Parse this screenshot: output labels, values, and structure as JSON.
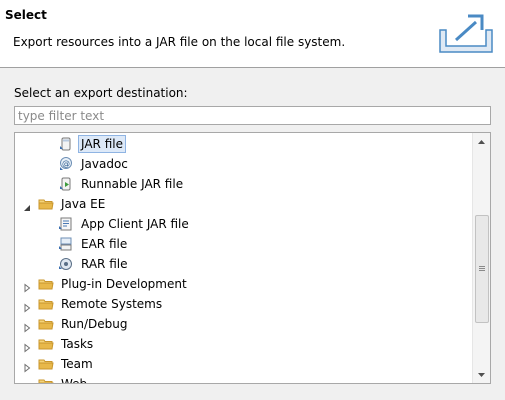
{
  "header": {
    "title": "Select",
    "description": "Export resources into a JAR file on the local file system.",
    "banner_icon": "export-icon"
  },
  "destination_label": "Select an export destination:",
  "filter": {
    "placeholder": "type filter text",
    "value": ""
  },
  "tree": {
    "selected": "JAR file",
    "items": [
      {
        "label": "JAR file",
        "icon": "jar-icon",
        "level": 2,
        "selected": true
      },
      {
        "label": "Javadoc",
        "icon": "javadoc-icon",
        "level": 2
      },
      {
        "label": "Runnable JAR file",
        "icon": "runnable-jar-icon",
        "level": 2
      },
      {
        "label": "Java EE",
        "icon": "folder-icon",
        "level": 1,
        "expanded": true
      },
      {
        "label": "App Client JAR file",
        "icon": "app-client-jar-icon",
        "level": 2
      },
      {
        "label": "EAR file",
        "icon": "ear-icon",
        "level": 2
      },
      {
        "label": "RAR file",
        "icon": "rar-icon",
        "level": 2
      },
      {
        "label": "Plug-in Development",
        "icon": "folder-icon",
        "level": 1,
        "expanded": false
      },
      {
        "label": "Remote Systems",
        "icon": "folder-icon",
        "level": 1,
        "expanded": false
      },
      {
        "label": "Run/Debug",
        "icon": "folder-icon",
        "level": 1,
        "expanded": false
      },
      {
        "label": "Tasks",
        "icon": "folder-icon",
        "level": 1,
        "expanded": false
      },
      {
        "label": "Team",
        "icon": "folder-icon",
        "level": 1,
        "expanded": false
      },
      {
        "label": "Web",
        "icon": "folder-icon",
        "level": 1,
        "expanded": false
      }
    ]
  },
  "colors": {
    "selection_bg": "#dde9f8",
    "selection_border": "#8fb4e3",
    "folder": "#e8b84a",
    "banner": "#4a8ac4"
  }
}
